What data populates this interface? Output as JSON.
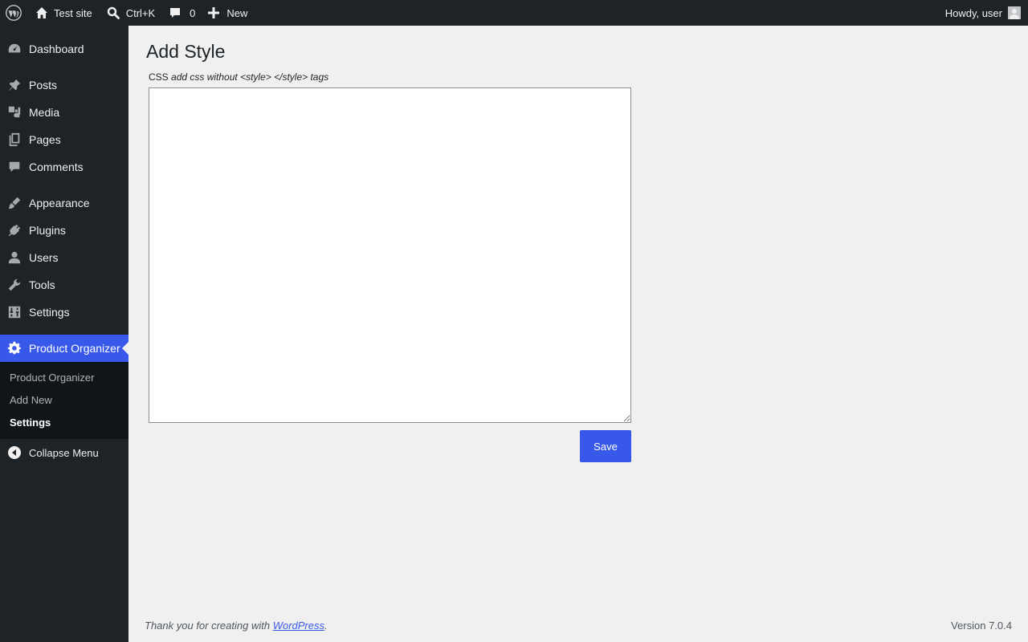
{
  "adminbar": {
    "site_name": "Test site",
    "search_shortcut": "Ctrl+K",
    "comments_count": "0",
    "new_label": "New",
    "greeting": "Howdy, user"
  },
  "sidebar": {
    "items": [
      {
        "label": "Dashboard",
        "icon": "dashboard-icon"
      },
      {
        "label": "Posts",
        "icon": "pin-icon"
      },
      {
        "label": "Media",
        "icon": "media-icon"
      },
      {
        "label": "Pages",
        "icon": "pages-icon"
      },
      {
        "label": "Comments",
        "icon": "comment-icon"
      },
      {
        "label": "Appearance",
        "icon": "brush-icon"
      },
      {
        "label": "Plugins",
        "icon": "plug-icon"
      },
      {
        "label": "Users",
        "icon": "user-icon"
      },
      {
        "label": "Tools",
        "icon": "wrench-icon"
      },
      {
        "label": "Settings",
        "icon": "sliders-icon"
      },
      {
        "label": "Product Organizer",
        "icon": "gear-icon"
      }
    ],
    "submenu": [
      "Product Organizer",
      "Add New",
      "Settings"
    ],
    "collapse_label": "Collapse Menu"
  },
  "main": {
    "title": "Add Style",
    "field_label": "CSS",
    "field_hint": "add css without <style> </style> tags",
    "textarea_value": "",
    "save_label": "Save"
  },
  "footer": {
    "thanks_prefix": "Thank you for creating with ",
    "link_text": "WordPress",
    "thanks_suffix": ".",
    "version": "Version 7.0.4"
  },
  "colors": {
    "accent": "#3858e9",
    "sidebar_bg": "#1d2327",
    "submenu_bg": "#101517",
    "page_bg": "#f0f0f1"
  }
}
